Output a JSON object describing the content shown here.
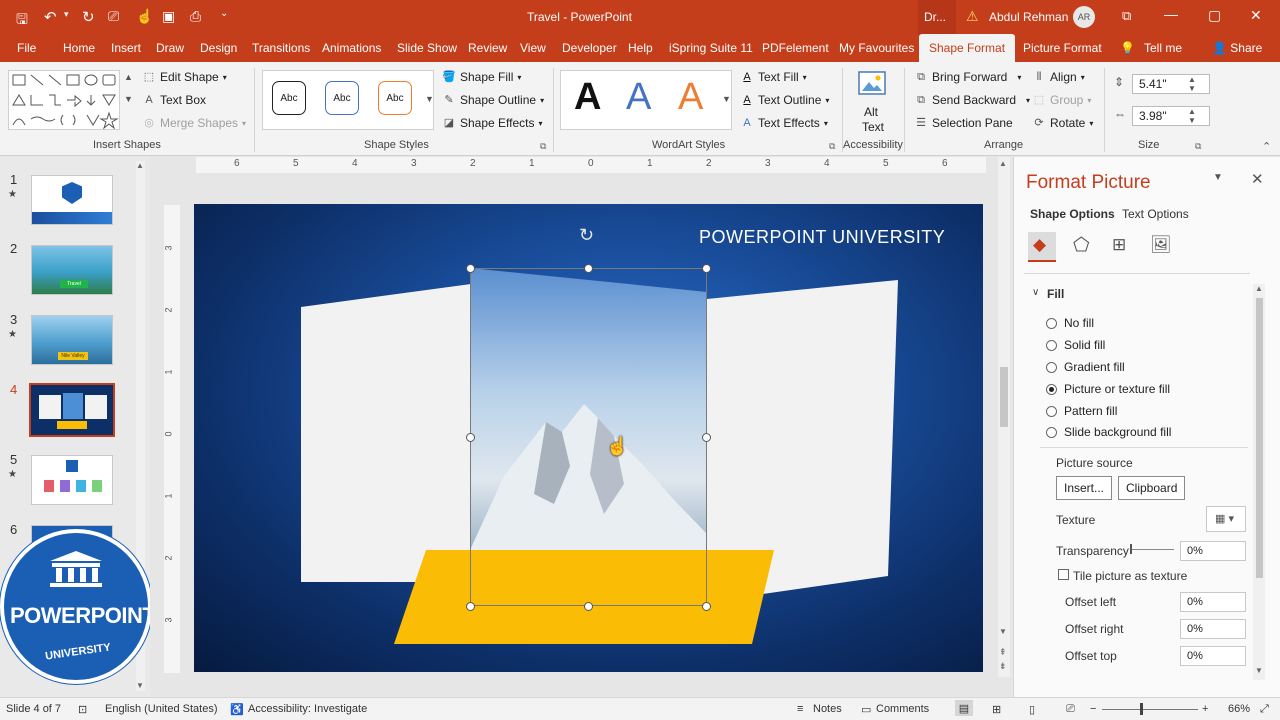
{
  "window": {
    "title": "Travel  -  PowerPoint",
    "search_hint": "Dr...",
    "user_name": "Abdul Rehman",
    "user_initials": "AR",
    "controls": [
      "—",
      "▢",
      "✕"
    ]
  },
  "tabs": [
    "File",
    "Home",
    "Insert",
    "Draw",
    "Design",
    "Transitions",
    "Animations",
    "Slide Show",
    "Review",
    "View",
    "Developer",
    "Help",
    "iSpring Suite 11",
    "PDFelement",
    "My Favourites",
    "Shape Format",
    "Picture Format",
    "Tell me",
    "Share"
  ],
  "active_tab": "Shape Format",
  "ribbon": {
    "insert_shapes": {
      "label": "Insert Shapes",
      "edit_shape": "Edit Shape",
      "text_box": "Text Box",
      "merge_shapes": "Merge Shapes"
    },
    "shape_styles": {
      "label": "Shape Styles",
      "preset_text": "Abc",
      "shape_fill": "Shape Fill",
      "shape_outline": "Shape Outline",
      "shape_effects": "Shape Effects"
    },
    "wordart": {
      "label": "WordArt Styles",
      "letter": "A",
      "text_fill": "Text Fill",
      "text_outline": "Text Outline",
      "text_effects": "Text Effects"
    },
    "accessibility": {
      "label": "Accessibility",
      "alt_text_1": "Alt",
      "alt_text_2": "Text"
    },
    "arrange": {
      "label": "Arrange",
      "bring_forward": "Bring Forward",
      "send_backward": "Send Backward",
      "selection_pane": "Selection Pane",
      "align": "Align",
      "group": "Group",
      "rotate": "Rotate"
    },
    "size": {
      "label": "Size",
      "height": "5.41\"",
      "width": "3.98\""
    }
  },
  "thumbnails": [
    {
      "num": "1",
      "star": true,
      "tag": ""
    },
    {
      "num": "2",
      "star": false,
      "tag": "Travel"
    },
    {
      "num": "3",
      "star": true,
      "tag": "Nile Valley"
    },
    {
      "num": "4",
      "star": false,
      "tag": ""
    },
    {
      "num": "5",
      "star": true,
      "tag": ""
    },
    {
      "num": "6",
      "star": false,
      "tag": ""
    }
  ],
  "selected_slide": "4",
  "ruler_labels": [
    "6",
    "5",
    "4",
    "3",
    "2",
    "1",
    "0",
    "1",
    "2",
    "3",
    "4",
    "5",
    "6"
  ],
  "vruler_labels": [
    "3",
    "2",
    "1",
    "0",
    "1",
    "2",
    "3"
  ],
  "slide": {
    "heading": "POWERPOINT UNIVERSITY"
  },
  "logo": {
    "line1": "POWERPOINT",
    "line2": "UNIVERSITY"
  },
  "format_pane": {
    "title": "Format Picture",
    "tab_shape": "Shape Options",
    "tab_text": "Text Options",
    "section": "Fill",
    "options": [
      "No fill",
      "Solid fill",
      "Gradient fill",
      "Picture or texture fill",
      "Pattern fill",
      "Slide background fill"
    ],
    "selected_option": "Picture or texture fill",
    "picture_source": "Picture source",
    "insert_btn": "Insert...",
    "clipboard_btn": "Clipboard",
    "texture": "Texture",
    "transparency": "Transparency",
    "transparency_val": "0%",
    "tile": "Tile picture as texture",
    "offset_left": "Offset left",
    "offset_right": "Offset right",
    "offset_top": "Offset top",
    "offset_left_val": "0%",
    "offset_right_val": "0%",
    "offset_top_val": "0%"
  },
  "status": {
    "slide_info": "Slide 4 of 7",
    "language": "English (United States)",
    "accessibility": "Accessibility: Investigate",
    "notes": "Notes",
    "comments": "Comments",
    "zoom": "66%"
  },
  "colors": {
    "accent": "#c43e1c",
    "slide_bg": "#1a4f9e",
    "yellow": "#fbbc05",
    "panel_white": "#f2f2f2"
  }
}
